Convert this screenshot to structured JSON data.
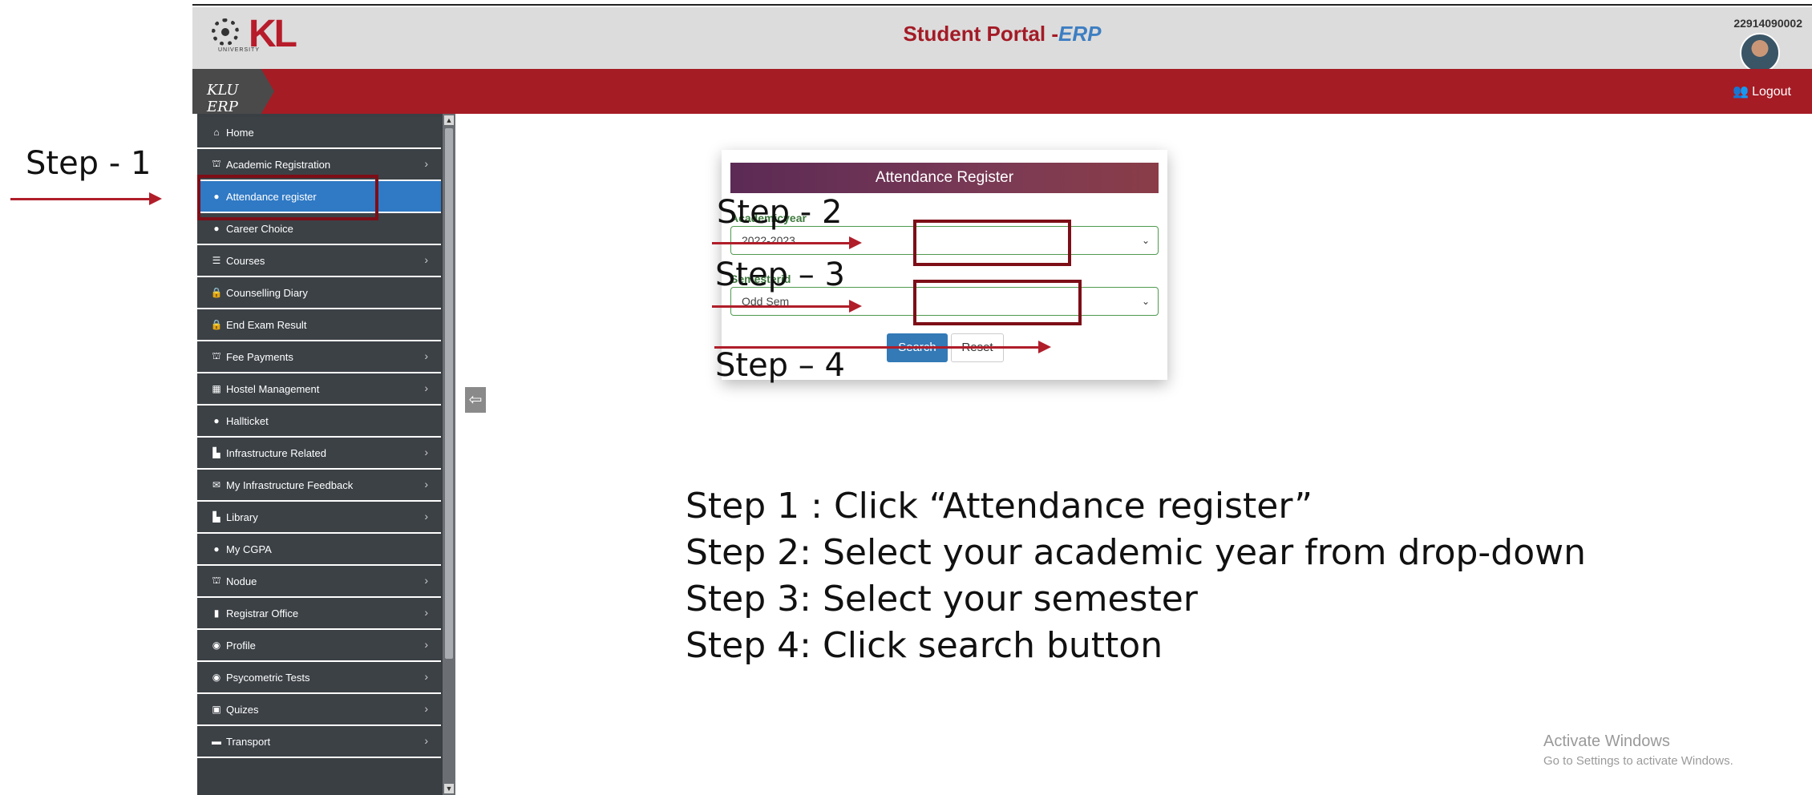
{
  "header": {
    "logo_text": "KL",
    "logo_sub": "UNIVERSITY",
    "title_main": "Student Portal -",
    "title_accent": "ERP",
    "user_id": "22914090002"
  },
  "navbar": {
    "brand": "KLU ERP",
    "logout_label": "Logout"
  },
  "sidebar": {
    "items": [
      {
        "label": "Home",
        "icon": "home-icon",
        "glyph": "⌂",
        "chevron": false
      },
      {
        "label": "Academic Registration",
        "icon": "bank-icon",
        "glyph": "⛫",
        "chevron": true
      },
      {
        "label": "Attendance register",
        "icon": "clock-icon",
        "glyph": "●",
        "chevron": false,
        "active": true
      },
      {
        "label": "Career Choice",
        "icon": "clock-icon",
        "glyph": "●",
        "chevron": false
      },
      {
        "label": "Courses",
        "icon": "list-icon",
        "glyph": "☰",
        "chevron": true
      },
      {
        "label": "Counselling Diary",
        "icon": "lock-icon",
        "glyph": "🔒",
        "chevron": false
      },
      {
        "label": "End Exam Result",
        "icon": "lock-icon",
        "glyph": "🔒",
        "chevron": false
      },
      {
        "label": "Fee Payments",
        "icon": "bank-icon",
        "glyph": "⛫",
        "chevron": true
      },
      {
        "label": "Hostel Management",
        "icon": "building-icon",
        "glyph": "▦",
        "chevron": true
      },
      {
        "label": "Hallticket",
        "icon": "clock-icon",
        "glyph": "●",
        "chevron": false
      },
      {
        "label": "Infrastructure Related",
        "icon": "industry-icon",
        "glyph": "▙",
        "chevron": true
      },
      {
        "label": "My Infrastructure Feedback",
        "icon": "comments-icon",
        "glyph": "✉",
        "chevron": true
      },
      {
        "label": "Library",
        "icon": "industry-icon",
        "glyph": "▙",
        "chevron": true
      },
      {
        "label": "My CGPA",
        "icon": "clock-icon",
        "glyph": "●",
        "chevron": false
      },
      {
        "label": "Nodue",
        "icon": "bank-icon",
        "glyph": "⛫",
        "chevron": true
      },
      {
        "label": "Registrar Office",
        "icon": "file-icon",
        "glyph": "▮",
        "chevron": true
      },
      {
        "label": "Profile",
        "icon": "user-circle-icon",
        "glyph": "◉",
        "chevron": true
      },
      {
        "label": "Psycometric Tests",
        "icon": "user-circle-icon",
        "glyph": "◉",
        "chevron": true
      },
      {
        "label": "Quizes",
        "icon": "bus-icon",
        "glyph": "▣",
        "chevron": true
      },
      {
        "label": "Transport",
        "icon": "truck-icon",
        "glyph": "▬",
        "chevron": true
      }
    ]
  },
  "form": {
    "title": "Attendance Register",
    "academic_year_label": "Academicyear",
    "academic_year_value": "2022-2023",
    "semester_label": "Semesterid",
    "semester_value": "Odd Sem",
    "search_label": "Search",
    "reset_label": "Reset"
  },
  "annotations": {
    "step1": "Step - 1",
    "step2": "Step - 2",
    "step3": "Step – 3",
    "step4": "Step – 4",
    "instructions": [
      "Step 1 : Click “Attendance register”",
      "Step 2: Select your academic year from drop-down",
      "Step 3: Select your semester",
      "Step 4: Click search button"
    ],
    "highlight_color": "#7d0e17",
    "arrow_color": "#b01e2a"
  },
  "watermark": {
    "line1": "Activate Windows",
    "line2": "Go to Settings to activate Windows."
  },
  "colors": {
    "brand_red": "#a51c25",
    "active_blue": "#2f79c5",
    "sidebar_bg": "#3c4146"
  }
}
